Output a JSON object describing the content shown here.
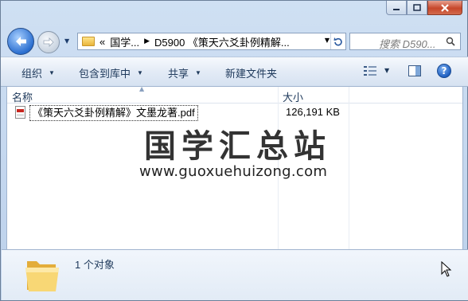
{
  "window": {
    "controls": {
      "minimize": "minimize",
      "maximize": "maximize",
      "close": "close"
    }
  },
  "navigation": {
    "back": "back",
    "forward": "forward",
    "breadcrumb": {
      "overflow": "«",
      "items": [
        "国学...",
        "D5900 《策天六爻卦例精解..."
      ]
    },
    "search_placeholder": "搜索 D590..."
  },
  "toolbar": {
    "organize": "组织",
    "include_in_library": "包含到库中",
    "share": "共享",
    "new_folder": "新建文件夹"
  },
  "columns": {
    "name": "名称",
    "size": "大小"
  },
  "files": [
    {
      "name": "《策天六爻卦例精解》文墨龙著.pdf",
      "size": "126,191 KB",
      "icon": "pdf-icon"
    }
  ],
  "watermark": {
    "title": "国学汇总站",
    "url": "www.guoxuehuizong.com"
  },
  "status": {
    "count": "1 个对象"
  },
  "colors": {
    "accent": "#2b6fd0",
    "close": "#c6462a",
    "folder": "#e9b53b"
  }
}
